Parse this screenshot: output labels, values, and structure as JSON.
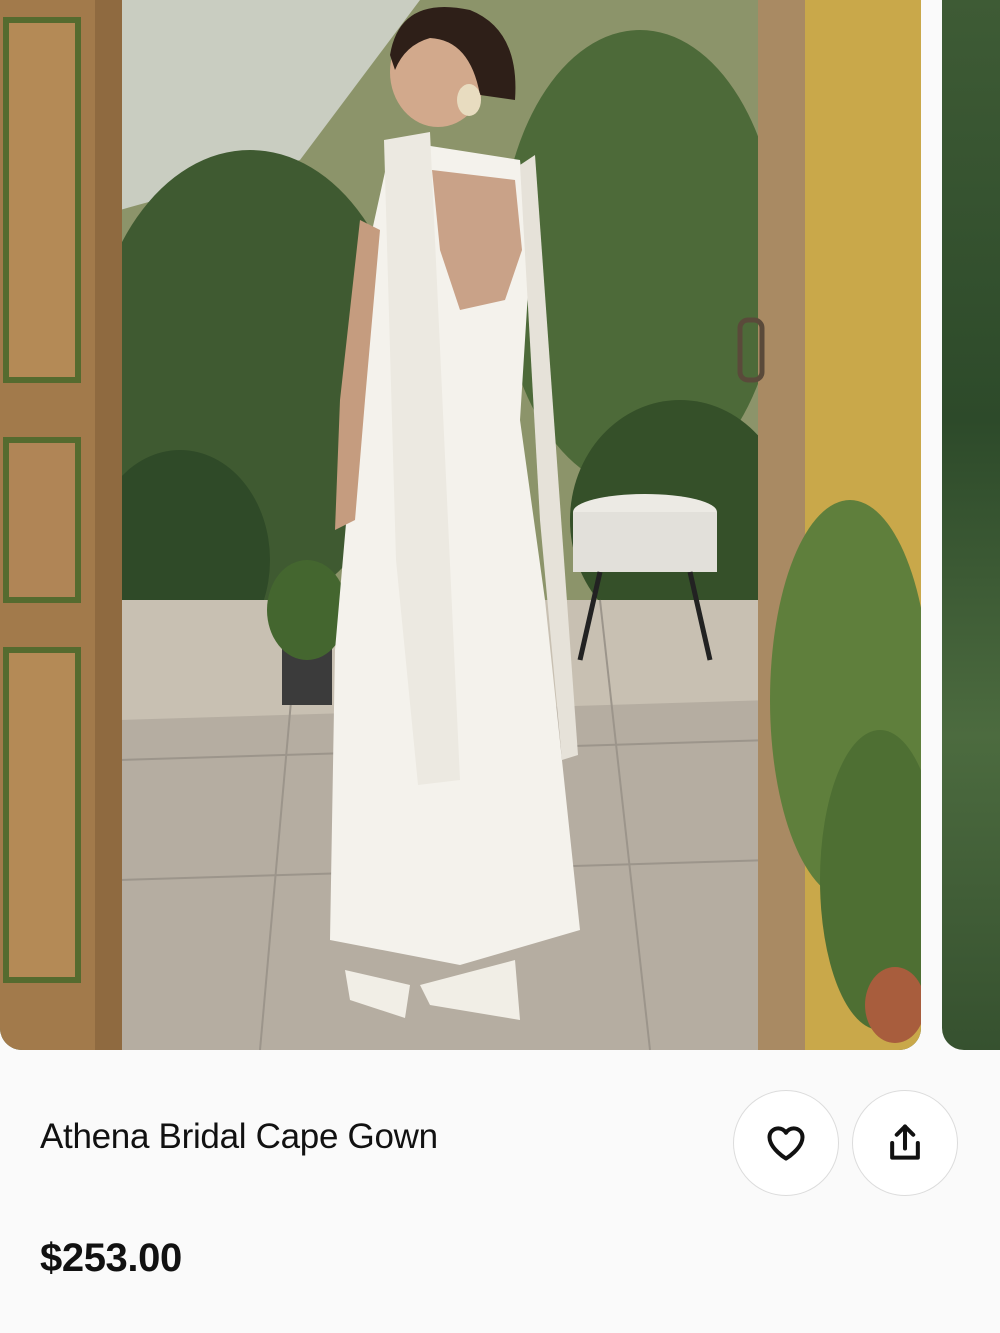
{
  "product": {
    "title": "Athena Bridal Cape Gown",
    "price": "$253.00"
  },
  "gallery": {
    "main_image": "model-in-white-cape-gown-in-greenhouse",
    "next_image": "greenery-photo-peek"
  },
  "actions": {
    "favorite_icon": "heart-icon",
    "share_icon": "share-upload-icon"
  },
  "colors": {
    "background": "#fafafa",
    "text": "#111111",
    "button_border": "#dcdcdc"
  }
}
